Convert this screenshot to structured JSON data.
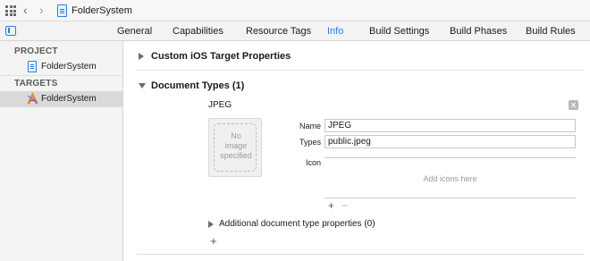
{
  "pathbar": {
    "project_name": "FolderSystem"
  },
  "tabs": [
    {
      "label": "General"
    },
    {
      "label": "Capabilities"
    },
    {
      "label": "Resource Tags"
    },
    {
      "label": "Info",
      "active": true
    },
    {
      "label": "Build Settings"
    },
    {
      "label": "Build Phases"
    },
    {
      "label": "Build Rules"
    }
  ],
  "sidebar": {
    "project_header": "PROJECT",
    "project_item": "FolderSystem",
    "targets_header": "TARGETS",
    "target_item": "FolderSystem"
  },
  "main": {
    "custom_properties": "Custom iOS Target Properties",
    "document_types": "Document Types (1)",
    "document": {
      "title": "JPEG",
      "image_placeholder_1": "No",
      "image_placeholder_2": "image",
      "image_placeholder_3": "specified",
      "name_label": "Name",
      "name_value": "JPEG",
      "types_label": "Types",
      "types_value": "public.jpeg",
      "icon_label": "Icon",
      "icon_hint": "Add icons here"
    },
    "additional_properties": "Additional document type properties (0)"
  },
  "colors": {
    "accent": "#2d7be6",
    "sidebar_bg": "#f4f4f4",
    "selected_row": "#d9d9d9"
  }
}
